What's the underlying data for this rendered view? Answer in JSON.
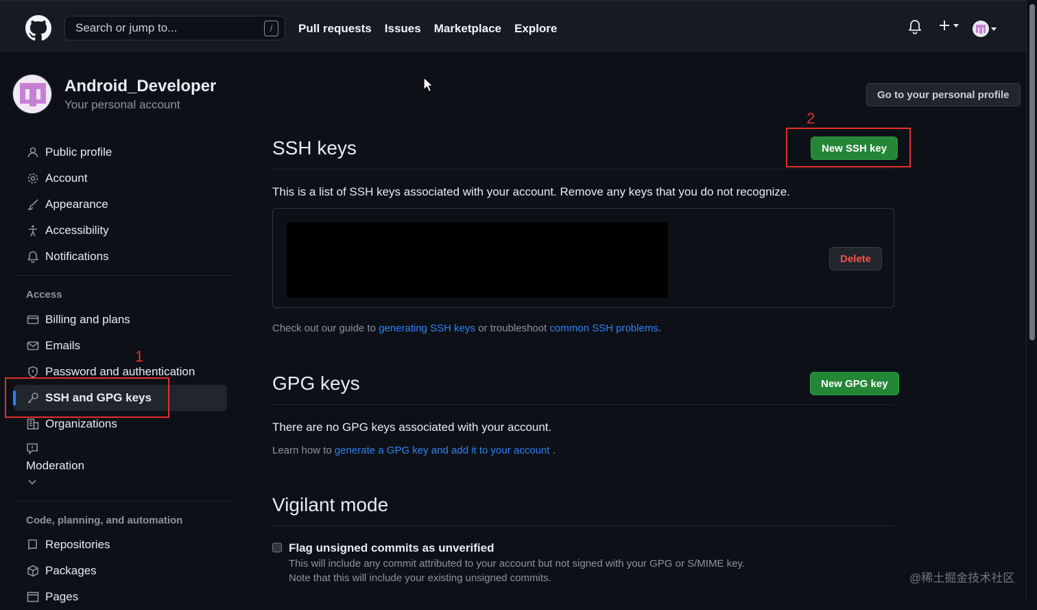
{
  "header": {
    "search_placeholder": "Search or jump to...",
    "slash_hint": "/",
    "nav": [
      "Pull requests",
      "Issues",
      "Marketplace",
      "Explore"
    ]
  },
  "account": {
    "name": "Android_Developer",
    "subtitle": "Your personal account",
    "profile_button": "Go to your personal profile"
  },
  "sidebar": {
    "items": [
      {
        "label": "Public profile",
        "icon": "person-icon"
      },
      {
        "label": "Account",
        "icon": "gear-icon"
      },
      {
        "label": "Appearance",
        "icon": "paintbrush-icon"
      },
      {
        "label": "Accessibility",
        "icon": "accessibility-icon"
      },
      {
        "label": "Notifications",
        "icon": "bell-icon"
      }
    ],
    "access_heading": "Access",
    "access_items": [
      {
        "label": "Billing and plans",
        "icon": "credit-card-icon"
      },
      {
        "label": "Emails",
        "icon": "mail-icon"
      },
      {
        "label": "Password and authentication",
        "icon": "shield-icon"
      },
      {
        "label": "SSH and GPG keys",
        "icon": "key-icon",
        "active": true
      },
      {
        "label": "Organizations",
        "icon": "organization-icon"
      },
      {
        "label": "Moderation",
        "icon": "report-icon"
      }
    ],
    "code_heading": "Code, planning, and automation",
    "code_items": [
      {
        "label": "Repositories",
        "icon": "repo-icon"
      },
      {
        "label": "Packages",
        "icon": "package-icon"
      },
      {
        "label": "Pages",
        "icon": "browser-icon"
      }
    ]
  },
  "ssh": {
    "title": "SSH keys",
    "new_button": "New SSH key",
    "description": "This is a list of SSH keys associated with your account. Remove any keys that you do not recognize.",
    "delete_button": "Delete",
    "guide_prefix": "Check out our guide to ",
    "guide_link1": "generating SSH keys",
    "guide_middle": " or troubleshoot ",
    "guide_link2": "common SSH problems",
    "guide_suffix": "."
  },
  "gpg": {
    "title": "GPG keys",
    "new_button": "New GPG key",
    "empty": "There are no GPG keys associated with your account.",
    "learn_prefix": "Learn how to ",
    "learn_link": "generate a GPG key and add it to your account",
    "learn_suffix": " ."
  },
  "vigilant": {
    "title": "Vigilant mode",
    "checkbox_label": "Flag unsigned commits as unverified",
    "desc_line1": "This will include any commit attributed to your account but not signed with your GPG or S/MIME key.",
    "desc_line2": "Note that this will include your existing unsigned commits.",
    "checked": false
  },
  "annotations": {
    "one": "1",
    "two": "2",
    "color": "#e5302b"
  },
  "watermark": "@稀土掘金技术社区",
  "colors": {
    "accent": "#2f81f7",
    "green": "#238636",
    "danger": "#f85149",
    "bg": "#0d1117"
  }
}
